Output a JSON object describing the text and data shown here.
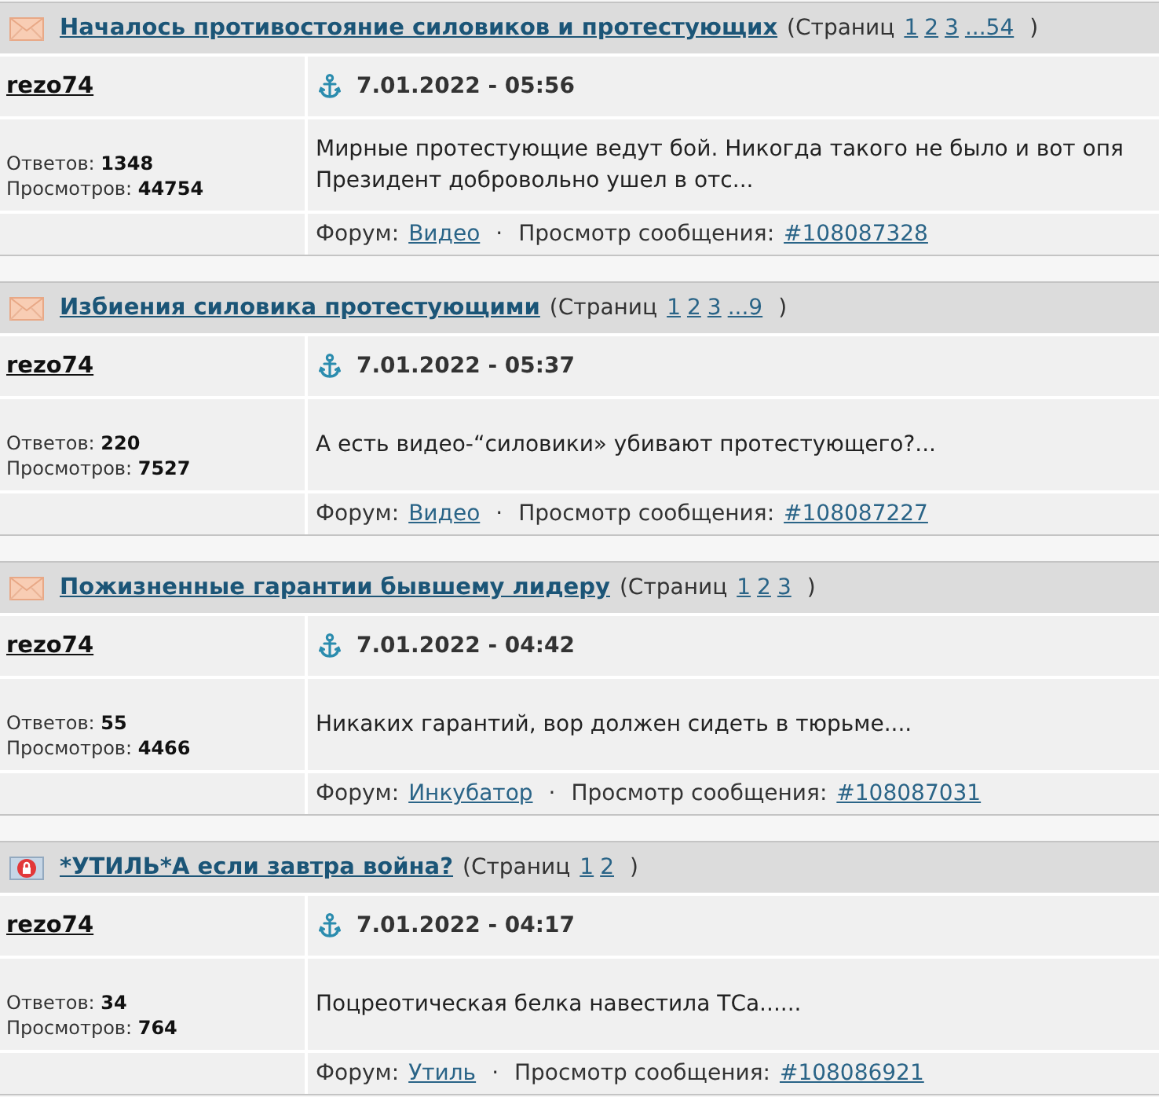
{
  "topics": [
    {
      "kind": "envelope",
      "title": "Началось противостояние силовиков и протестующих",
      "pages_open": "(Страниц",
      "pages": [
        "1",
        "2",
        "3",
        "...54"
      ],
      "pages_close": ")",
      "author": "rezo74",
      "date": "7.01.2022 - 05:56",
      "replies": "Ответов: **1348**",
      "views": "Просмотров: **44754**",
      "message_lines": [
        "Мирные протестующие ведут бой. Никогда такого не было и вот опя",
        "Президент добровольно ушел в отс..."
      ],
      "forum_label": "Форум:",
      "forum": "Видео",
      "separator": "·",
      "post_label": "Просмотр сообщения:",
      "post_id": "#108087328"
    },
    {
      "kind": "envelope",
      "title": "Избиения силовика протестующими",
      "pages_open": "(Страниц",
      "pages": [
        "1",
        "2",
        "3",
        "...9"
      ],
      "pages_close": ")",
      "author": "rezo74",
      "date": "7.01.2022 - 05:37",
      "replies": "Ответов: **220**",
      "views": "Просмотров: **7527**",
      "message_lines": [
        "А есть видео-“силовики» убивают протестующего?..."
      ],
      "forum_label": "Форум:",
      "forum": "Видео",
      "separator": "·",
      "post_label": "Просмотр сообщения:",
      "post_id": "#108087227"
    },
    {
      "kind": "envelope",
      "title": "Пожизненные гарантии бывшему лидеру",
      "pages_open": "(Страниц",
      "pages": [
        "1",
        "2",
        "3"
      ],
      "pages_close": ")",
      "author": "rezo74",
      "date": "7.01.2022 - 04:42",
      "replies": "Ответов: **55**",
      "views": "Просмотров: **4466**",
      "message_lines": [
        "Никаких гарантий, вор должен сидеть в тюрьме...."
      ],
      "forum_label": "Форум:",
      "forum": "Инкубатор",
      "separator": "·",
      "post_label": "Просмотр сообщения:",
      "post_id": "#108087031"
    },
    {
      "kind": "locked",
      "title": "*УТИЛЬ*А если завтра война?",
      "pages_open": "(Страниц",
      "pages": [
        "1",
        "2"
      ],
      "pages_close": ")",
      "author": "rezo74",
      "date": "7.01.2022 - 04:17",
      "replies": "Ответов: **34**",
      "views": "Просмотров: **764**",
      "message_lines": [
        "Поцреотическая белка навестила ТСа......"
      ],
      "forum_label": "Форум:",
      "forum": "Утиль",
      "separator": "·",
      "post_label": "Просмотр сообщения:",
      "post_id": "#108086921"
    }
  ]
}
